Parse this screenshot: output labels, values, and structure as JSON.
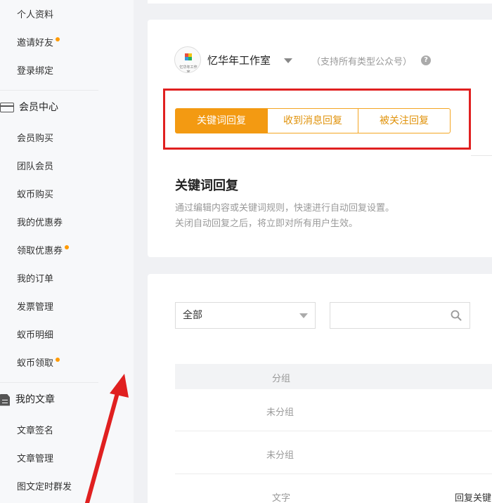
{
  "sidebar": {
    "items_top": [
      {
        "label": "个人资料",
        "dot": false
      },
      {
        "label": "邀请好友",
        "dot": true
      },
      {
        "label": "登录绑定",
        "dot": false
      }
    ],
    "member_section": {
      "title": "会员中心",
      "icon": "card-icon",
      "items": [
        {
          "label": "会员购买",
          "dot": false
        },
        {
          "label": "团队会员",
          "dot": false
        },
        {
          "label": "蚁币购买",
          "dot": false
        },
        {
          "label": "我的优惠券",
          "dot": false
        },
        {
          "label": "领取优惠券",
          "dot": true
        },
        {
          "label": "我的订单",
          "dot": false
        },
        {
          "label": "发票管理",
          "dot": false
        },
        {
          "label": "蚁币明细",
          "dot": false
        },
        {
          "label": "蚁币领取",
          "dot": true
        }
      ]
    },
    "article_section": {
      "title": "我的文章",
      "icon": "document-icon",
      "items": [
        {
          "label": "文章签名",
          "dot": false
        },
        {
          "label": "文章管理",
          "dot": false
        },
        {
          "label": "图文定时群发",
          "dot": false
        }
      ]
    },
    "dot_color": "#ff9a00"
  },
  "account": {
    "name": "忆华年工作室",
    "logo_text": "忆华年工作室",
    "hint": "（支持所有类型公众号）",
    "help": "?"
  },
  "tabs": [
    {
      "label": "关键词回复",
      "active": true
    },
    {
      "label": "收到消息回复",
      "active": false
    },
    {
      "label": "被关注回复",
      "active": false
    }
  ],
  "intro": {
    "title": "关键词回复",
    "desc_line1": "通过编辑内容或关键词规则，快速进行自动回复设置。",
    "desc_line2": "关闭自动回复之后，将立即对所有用户生效。"
  },
  "filters": {
    "group_select": "全部",
    "search_value": "",
    "search_placeholder": ""
  },
  "table": {
    "headers": [
      "分组"
    ],
    "rows": [
      {
        "group": "未分组",
        "content": ""
      },
      {
        "group": "未分组",
        "content": ""
      },
      {
        "group": "文字",
        "content": "回复关键"
      }
    ]
  },
  "colors": {
    "accent": "#f39a12",
    "highlight_box": "#e02020",
    "arrow": "#e02020"
  }
}
